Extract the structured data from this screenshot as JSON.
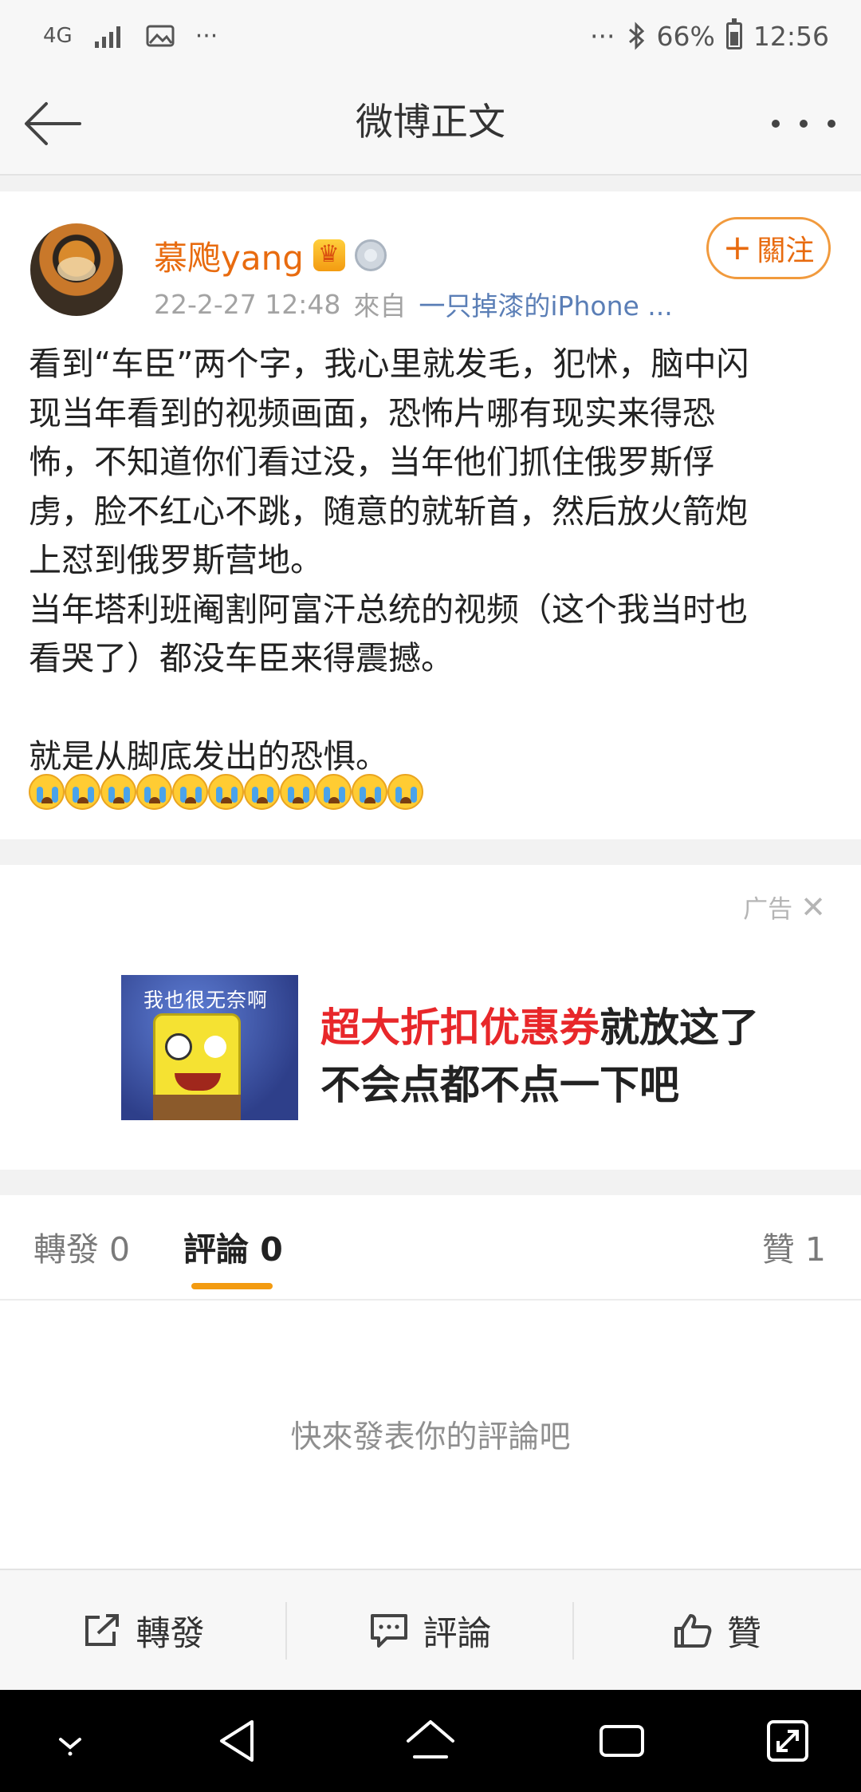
{
  "status_bar": {
    "network": "4G",
    "dots_left": "···",
    "dots_right": "···",
    "battery": "66%",
    "time": "12:56"
  },
  "nav": {
    "title": "微博正文"
  },
  "post": {
    "username": "慕飑yang",
    "date": "22-2-27 12:48",
    "from_label": "來自",
    "source": "一只掉漆的iPhone ...",
    "follow_label": "關注",
    "text": "看到“车臣”两个字，我心里就发毛，犯怵，脑中闪\n现当年看到的视频画面，恐怖片哪有现实来得恐\n怖，不知道你们看过没，当年他们抓住俄罗斯俘\n虏，脸不红心不跳，随意的就斩首，然后放火箭炮\n上怼到俄罗斯营地。\n当年塔利班阉割阿富汗总统的视频（这个我当时也\n看哭了）都没车臣来得震撼。\n\n就是从脚底发出的恐惧。",
    "emoji_count": 11,
    "emoji_icon": "crying-face-icon"
  },
  "ad": {
    "label": "广告",
    "image_text": "我也很无奈啊",
    "copy_red": "超大折扣优惠券",
    "copy_line1_rest": "就放这了",
    "copy_line2": "不会点都不点一下吧"
  },
  "tabs": {
    "repost_label": "轉發",
    "repost_count": "0",
    "comment_label": "評論",
    "comment_count": "0",
    "like_label": "贊",
    "like_count": "1"
  },
  "comments": {
    "empty_text": "快來發表你的評論吧"
  },
  "action_bar": {
    "repost": "轉發",
    "comment": "評論",
    "like": "贊"
  },
  "colors": {
    "accent_orange": "#e86b0f",
    "tab_underline": "#f39b11",
    "source_blue": "#5a7eb6",
    "ad_red": "#e8272a"
  }
}
